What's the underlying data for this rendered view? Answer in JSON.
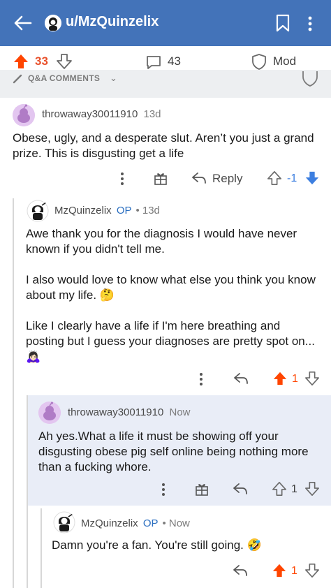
{
  "header": {
    "title": "u/MzQuinzelix",
    "icons": [
      "back-arrow-icon",
      "avatar",
      "bookmark-icon",
      "more-vertical-icon"
    ]
  },
  "post_actions": {
    "upvotes": "33",
    "comments": "43",
    "mod_label": "Mod"
  },
  "comments_bar": {
    "label": "Q&A COMMENTS",
    "chevron": "⌄"
  },
  "comments": [
    {
      "user": "throwaway30011910",
      "time": "13d",
      "body": [
        "Obese, ugly, and a desperate slut. Aren’t you just a grand prize. This is disgusting get a life"
      ],
      "reply_label": "Reply",
      "score": "-1",
      "vote": "down"
    },
    {
      "user": "MzQuinzelix",
      "op": "OP",
      "time": "13d",
      "body": [
        "Awe thank you for the diagnosis I would have never known if you didn't tell me.",
        "I also would love to know what else you think you know about my life. 🤔",
        "Like I clearly have a life if I'm here breathing and posting but I guess your diagnoses are pretty spot on...🙇🏻‍♀️"
      ],
      "score": "1",
      "vote": "up"
    },
    {
      "user": "throwaway30011910",
      "time": "Now",
      "body": [
        "Ah yes.What a life it must be showing off your disgusting obese pig self online being nothing more than a fucking whore."
      ],
      "score": "1",
      "vote": "none"
    },
    {
      "user": "MzQuinzelix",
      "op": "OP",
      "time": "Now",
      "body": [
        "Damn you're a fan. You're still going. 🤣"
      ],
      "score": "1",
      "vote": "up"
    }
  ],
  "colors": {
    "header_bg": "#4373b9",
    "upvote": "#ff4500",
    "downvote": "#3d7fe0",
    "op": "#2a6ec0",
    "highlight": "#e9edf7"
  }
}
